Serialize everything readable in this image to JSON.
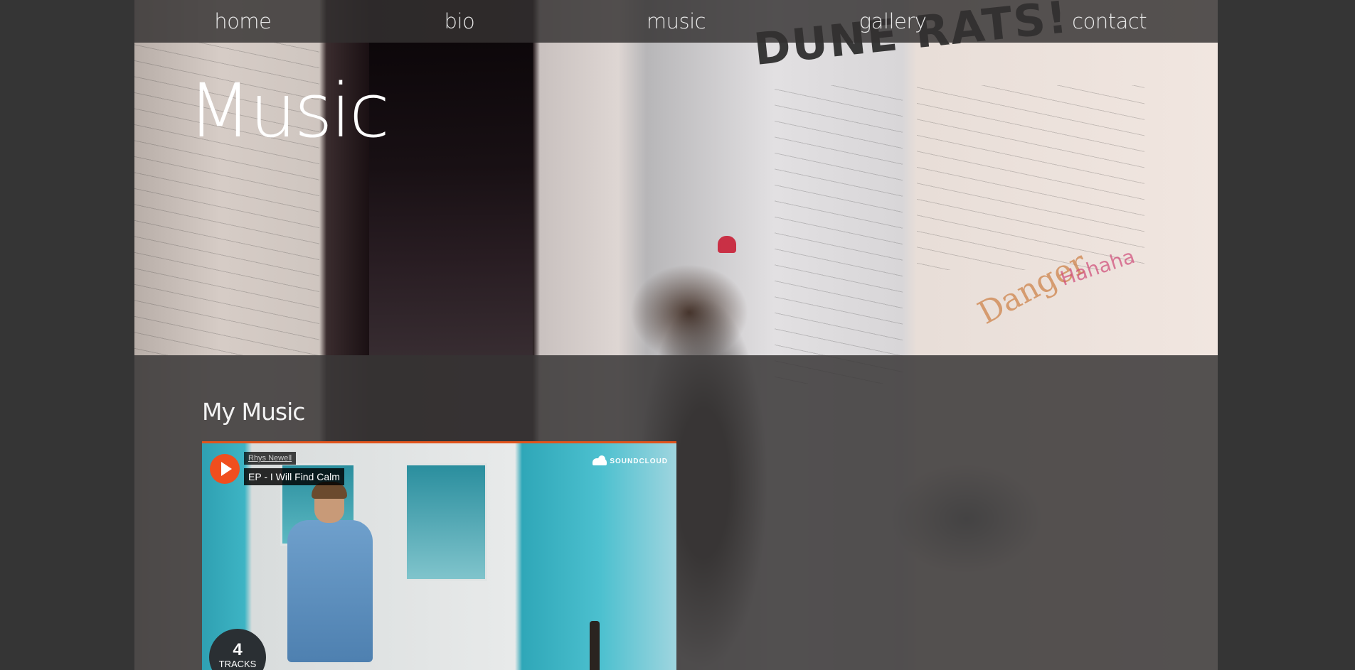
{
  "nav": {
    "items": [
      {
        "label": "home"
      },
      {
        "label": "bio"
      },
      {
        "label": "music"
      },
      {
        "label": "gallery"
      },
      {
        "label": "contact"
      }
    ]
  },
  "hero": {
    "title": "Music"
  },
  "section": {
    "title": "My Music"
  },
  "soundcloud": {
    "artist": "Rhys Newell",
    "track_title": "EP - I Will Find Calm",
    "brand": "SOUNDCLOUD",
    "track_count": "4",
    "track_count_label": "TRACKS",
    "accent_color": "#f04e1e"
  },
  "background_graffiti": {
    "large_text": "DUNE RATS!",
    "orange_text": "Danger",
    "pink_text": "Hahaha"
  },
  "colors": {
    "page_bg": "#353535",
    "nav_bg": "#323030",
    "soundcloud_orange": "#e2541c"
  }
}
